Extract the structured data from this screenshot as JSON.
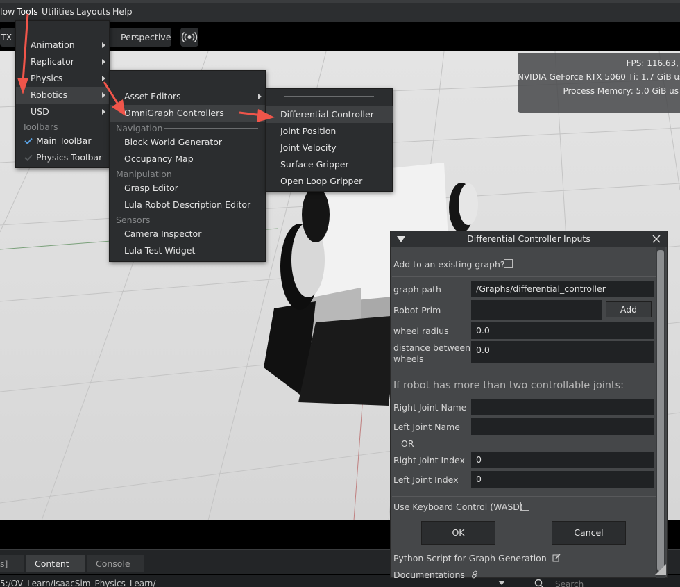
{
  "menubar": {
    "items": [
      "low",
      "Tools",
      "Utilities",
      "Layouts",
      "Help"
    ]
  },
  "toolbar": {
    "renderer_label": "TX -",
    "perspective_label": "Perspective"
  },
  "stats": {
    "fps": "FPS: 116.63,",
    "gpu": "NVIDIA GeForce RTX 5060 Ti: 1.7 GiB us",
    "memory": "Process Memory: 5.0 GiB us"
  },
  "tools_menu": {
    "items": [
      "Animation",
      "Replicator",
      "Physics",
      "Robotics",
      "USD"
    ],
    "toolbars_header": "Toolbars",
    "toolbar_items": [
      "Main ToolBar",
      "Physics Toolbar"
    ]
  },
  "robotics_menu": {
    "items": [
      "Asset Editors",
      "OmniGraph Controllers"
    ],
    "navigation_header": "Navigation",
    "navigation_items": [
      "Block World Generator",
      "Occupancy Map"
    ],
    "manipulation_header": "Manipulation",
    "manipulation_items": [
      "Grasp Editor",
      "Lula Robot Description Editor"
    ],
    "sensors_header": "Sensors",
    "sensors_items": [
      "Camera Inspector",
      "Lula Test Widget"
    ]
  },
  "controllers_menu": {
    "items": [
      "Differential Controller",
      "Joint Position",
      "Joint Velocity",
      "Surface Gripper",
      "Open Loop Gripper"
    ]
  },
  "dialog": {
    "title": "Differential Controller Inputs",
    "add_existing_label": "Add to an existing graph?",
    "graph_path_label": "graph path",
    "graph_path_value": "/Graphs/differential_controller",
    "robot_prim_label": "Robot Prim",
    "robot_prim_value": "",
    "add_label": "Add",
    "wheel_radius_label": "wheel radius",
    "wheel_radius_value": "0.0",
    "wheel_distance_label_1": "distance between",
    "wheel_distance_label_2": "wheels",
    "wheel_distance_value": "0.0",
    "section_header": "If robot has more than two controllable joints:",
    "right_joint_name_label": "Right Joint Name",
    "right_joint_name_value": "",
    "left_joint_name_label": "Left Joint Name",
    "left_joint_name_value": "",
    "or_label": "OR",
    "right_joint_index_label": "Right Joint Index",
    "right_joint_index_value": "0",
    "left_joint_index_label": "Left Joint Index",
    "left_joint_index_value": "0",
    "keyboard_label": "Use Keyboard Control (WASD)",
    "ok_label": "OK",
    "cancel_label": "Cancel",
    "python_script_label": "Python Script for Graph Generation",
    "documentations_label": "Documentations"
  },
  "bottom_tabs": {
    "items": [
      "s]",
      "Content",
      "Console"
    ]
  },
  "path_bar": {
    "path": "5:/OV_Learn/IsaacSim_Physics_Learn/",
    "search_placeholder": "Search"
  }
}
